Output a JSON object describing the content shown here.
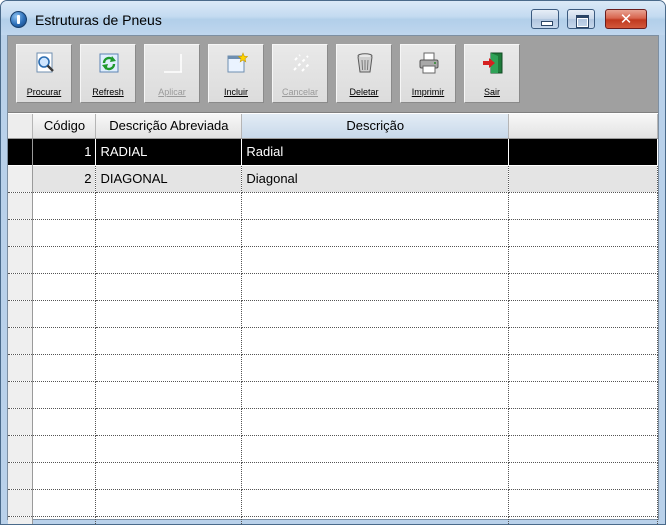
{
  "window": {
    "title": "Estruturas de Pneus",
    "close_glyph": "✕"
  },
  "toolbar": {
    "buttons": [
      {
        "label": "Procurar",
        "icon": "search-document-icon",
        "enabled": true
      },
      {
        "label": "Refresh",
        "icon": "refresh-icon",
        "enabled": true
      },
      {
        "label": "Aplicar",
        "icon": "apply-icon",
        "enabled": false
      },
      {
        "label": "Incluir",
        "icon": "new-record-icon",
        "enabled": true
      },
      {
        "label": "Cancelar",
        "icon": "cancel-icon",
        "enabled": false
      },
      {
        "label": "Deletar",
        "icon": "trash-icon",
        "enabled": true
      },
      {
        "label": "Imprimir",
        "icon": "printer-icon",
        "enabled": true
      },
      {
        "label": "Sair",
        "icon": "exit-door-icon",
        "enabled": true
      }
    ]
  },
  "grid": {
    "columns": [
      "Código",
      "Descrição Abreviada",
      "Descrição"
    ],
    "rows": [
      {
        "codigo": "1",
        "abreviada": "RADIAL",
        "descricao": "Radial",
        "selected": true
      },
      {
        "codigo": "2",
        "abreviada": "DIAGONAL",
        "descricao": "Diagonal",
        "selected": false
      }
    ]
  },
  "colors": {
    "selection_bg": "#000000",
    "selection_fg": "#ffffff",
    "toolbar_bg": "#a0a0a0",
    "window_frame": "#b9d1ea",
    "close_button": "#c0391f"
  }
}
